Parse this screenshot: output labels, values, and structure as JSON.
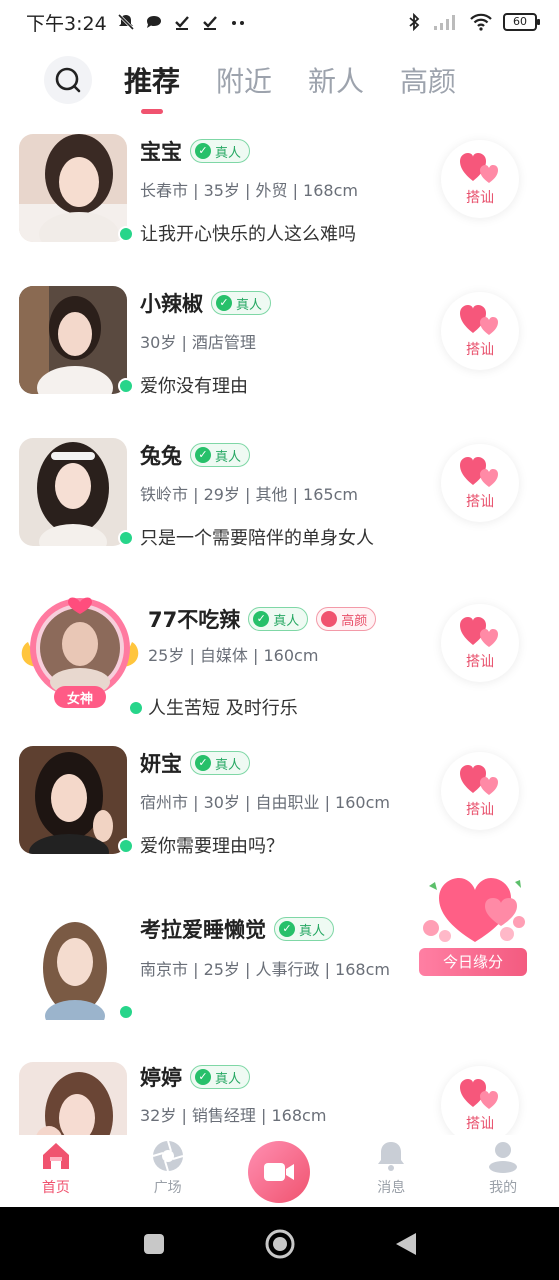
{
  "status_bar": {
    "time": "下午3:24",
    "battery": "60"
  },
  "tabs": [
    {
      "label": "推荐"
    },
    {
      "label": "附近"
    },
    {
      "label": "新人"
    },
    {
      "label": "高颜"
    }
  ],
  "users": [
    {
      "name": "宝宝",
      "badge_real": "真人",
      "info": "长春市 | 35岁 | 外贸 | 168cm",
      "motto": "让我开心快乐的人这么难吗",
      "greet": "搭讪"
    },
    {
      "name": "小辣椒",
      "badge_real": "真人",
      "info": "30岁 | 酒店管理",
      "motto": "爱你没有理由",
      "greet": "搭讪"
    },
    {
      "name": "兔兔",
      "badge_real": "真人",
      "info": "铁岭市 | 29岁 | 其他 | 165cm",
      "motto": "只是一个需要陪伴的单身女人",
      "greet": "搭讪"
    },
    {
      "name": "77不吃辣",
      "badge_real": "真人",
      "badge_extra": "高颜",
      "vip_tag": "女神",
      "info": "25岁 | 自媒体 | 160cm",
      "motto": "人生苦短 及时行乐",
      "greet": "搭讪"
    },
    {
      "name": "妍宝",
      "badge_real": "真人",
      "info": "宿州市 | 30岁 | 自由职业 | 160cm",
      "motto": "爱你需要理由吗？",
      "greet": "搭讪"
    },
    {
      "name": "考拉爱睡懒觉",
      "badge_real": "真人",
      "info": "南京市 | 25岁 | 人事行政 | 168cm",
      "motto": "",
      "greet": ""
    },
    {
      "name": "婷婷",
      "badge_real": "真人",
      "info": "32岁 | 销售经理 | 168cm",
      "motto": "",
      "greet": "搭讪"
    }
  ],
  "fate_button": "今日缘分",
  "bottom_nav": {
    "home": "首页",
    "square": "广场",
    "messages": "消息",
    "mine": "我的"
  },
  "colors": {
    "accent": "#f0536f",
    "online": "#27d58a",
    "real_badge": "#27a863"
  }
}
